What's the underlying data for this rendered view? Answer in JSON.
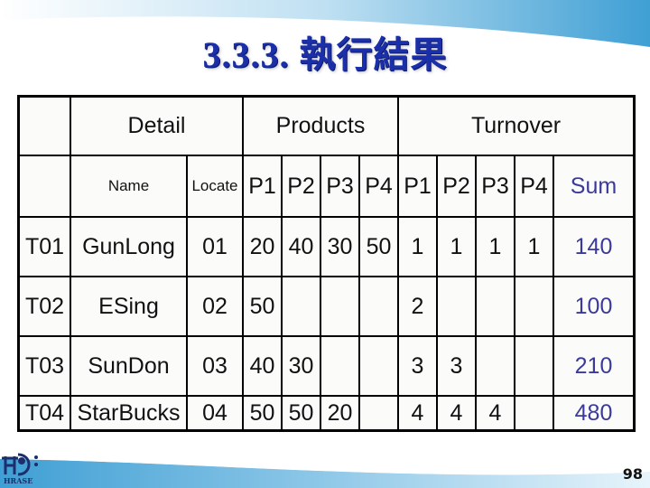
{
  "slide": {
    "title": "3.3.3. 執行結果",
    "page_number": "98",
    "logo_text": "HRASE"
  },
  "table": {
    "group_headers": {
      "blank": "",
      "detail": "Detail",
      "products": "Products",
      "turnover": "Turnover"
    },
    "sub_headers": {
      "blank": "",
      "name": "Name",
      "locate": "Locate",
      "products": [
        "P1",
        "P2",
        "P3",
        "P4"
      ],
      "turnover": [
        "P1",
        "P2",
        "P3",
        "P4"
      ],
      "sum": "Sum"
    },
    "rows": [
      {
        "id": "T01",
        "name": "GunLong",
        "locate": "01",
        "products": [
          "20",
          "40",
          "30",
          "50"
        ],
        "turnover": [
          "1",
          "1",
          "1",
          "1"
        ],
        "sum": "140"
      },
      {
        "id": "T02",
        "name": "ESing",
        "locate": "02",
        "products": [
          "50",
          "",
          "",
          ""
        ],
        "turnover": [
          "2",
          "",
          "",
          ""
        ],
        "sum": "100"
      },
      {
        "id": "T03",
        "name": "SunDon",
        "locate": "03",
        "products": [
          "40",
          "30",
          "",
          ""
        ],
        "turnover": [
          "3",
          "3",
          "",
          ""
        ],
        "sum": "210"
      },
      {
        "id": "T04",
        "name": "StarBucks",
        "locate": "04",
        "products": [
          "50",
          "50",
          "20",
          ""
        ],
        "turnover": [
          "4",
          "4",
          "4",
          ""
        ],
        "sum": "480"
      }
    ]
  },
  "colors": {
    "title": "#1a2fa8",
    "sum_text": "#3a3a9a",
    "swoosh": "#4aa3d6"
  }
}
